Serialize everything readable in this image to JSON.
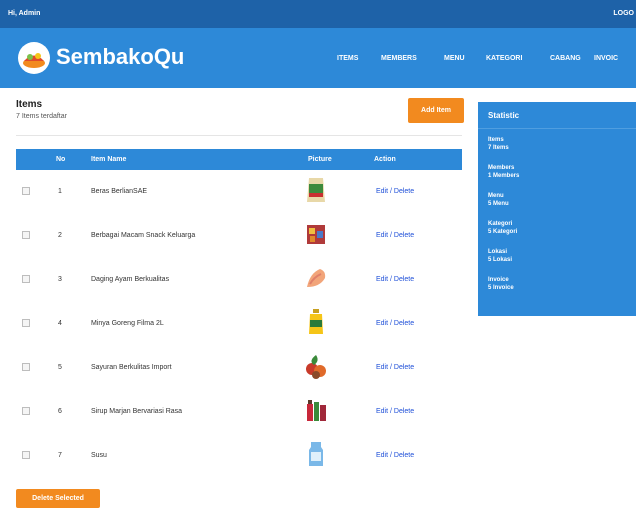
{
  "topbar": {
    "greeting": "Hi, Admin",
    "logout": "LOGO"
  },
  "header": {
    "brand": "SembakoQu",
    "nav": [
      "ITEMS",
      "MEMBERS",
      "MENU",
      "KATEGORI",
      "CABANG",
      "INVOIC"
    ]
  },
  "items": {
    "title": "Items",
    "subtitle": "7 Items terdaftar",
    "add_label": "Add Item",
    "columns": [
      "No",
      "Item Name",
      "Picture",
      "Action"
    ],
    "rows": [
      {
        "no": "1",
        "name": "Beras BerlianSAE",
        "edit": "Edit",
        "delete": "Delete",
        "icon": "rice-bag-icon"
      },
      {
        "no": "2",
        "name": "Berbagai Macam Snack Keluarga",
        "edit": "Edit",
        "delete": "Delete",
        "icon": "snack-box-icon"
      },
      {
        "no": "3",
        "name": "Daging Ayam Berkualitas",
        "edit": "Edit",
        "delete": "Delete",
        "icon": "chicken-meat-icon"
      },
      {
        "no": "4",
        "name": "Minya Goreng Filma 2L",
        "edit": "Edit",
        "delete": "Delete",
        "icon": "cooking-oil-icon"
      },
      {
        "no": "5",
        "name": "Sayuran Berkulitas Import",
        "edit": "Edit",
        "delete": "Delete",
        "icon": "vegetables-icon"
      },
      {
        "no": "6",
        "name": "Sirup Marjan Bervariasi Rasa",
        "edit": "Edit",
        "delete": "Delete",
        "icon": "syrup-bottles-icon"
      },
      {
        "no": "7",
        "name": "Susu",
        "edit": "Edit",
        "delete": "Delete",
        "icon": "milk-carton-icon"
      }
    ],
    "delete_selected": "Delete Selected"
  },
  "statistic": {
    "title": "Statistic",
    "entries": [
      {
        "label": "Items",
        "value": "7 Items"
      },
      {
        "label": "Members",
        "value": "1 Members"
      },
      {
        "label": "Menu",
        "value": "5 Menu"
      },
      {
        "label": "Kategori",
        "value": "5 Kategori"
      },
      {
        "label": "Lokasi",
        "value": "5 Lokasi"
      },
      {
        "label": "Invoice",
        "value": "5 Invoice"
      }
    ]
  },
  "colors": {
    "topbar": "#1e62a8",
    "header": "#2d89d8",
    "accent": "#f28a1f",
    "link": "#1e4fd8"
  }
}
